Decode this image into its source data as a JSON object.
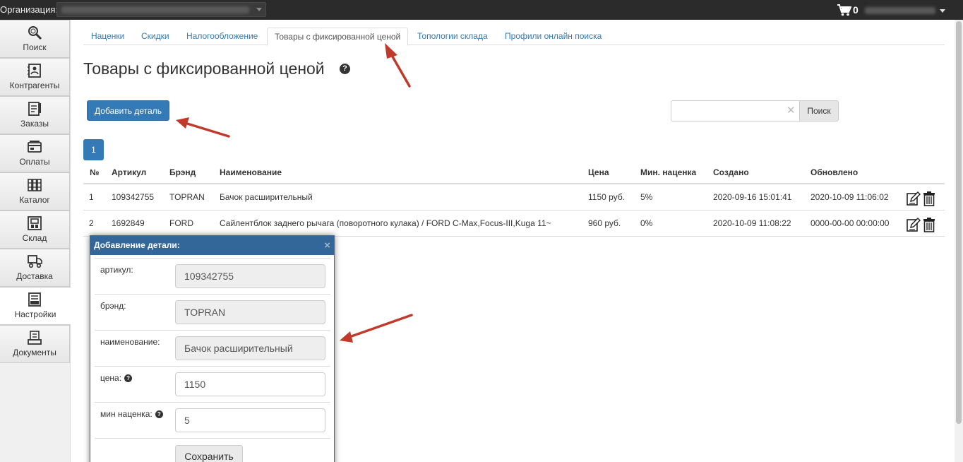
{
  "topbar": {
    "org_label": "Организация:",
    "cart_count": "0"
  },
  "sidebar": {
    "items": [
      {
        "label": "Поиск",
        "icon": "search-icon"
      },
      {
        "label": "Контрагенты",
        "icon": "contacts-icon"
      },
      {
        "label": "Заказы",
        "icon": "orders-icon"
      },
      {
        "label": "Оплаты",
        "icon": "payments-icon"
      },
      {
        "label": "Каталог",
        "icon": "catalog-icon"
      },
      {
        "label": "Склад",
        "icon": "warehouse-icon"
      },
      {
        "label": "Доставка",
        "icon": "delivery-icon"
      },
      {
        "label": "Настройки",
        "icon": "settings-icon",
        "active": true
      },
      {
        "label": "Документы",
        "icon": "documents-icon"
      }
    ]
  },
  "tabs": [
    {
      "label": "Наценки"
    },
    {
      "label": "Скидки"
    },
    {
      "label": "Налогообложение"
    },
    {
      "label": "Товары с фиксированной ценой",
      "active": true
    },
    {
      "label": "Топологии склада"
    },
    {
      "label": "Профили онлайн поиска"
    }
  ],
  "page": {
    "title": "Товары с фиксированной ценой",
    "add_button": "Добавить деталь",
    "search_button": "Поиск",
    "search_placeholder": "",
    "search_clear": "✕",
    "current_page": "1"
  },
  "table": {
    "headers": [
      "№",
      "Артикул",
      "Брэнд",
      "Наименование",
      "Цена",
      "Мин. наценка",
      "Создано",
      "Обновлено"
    ],
    "rows": [
      [
        "1",
        "109342755",
        "TOPRAN",
        "Бачок расширительный",
        "1150 руб.",
        "5%",
        "2020-09-16 15:01:41",
        "2020-10-09 11:06:02"
      ],
      [
        "2",
        "1692849",
        "FORD",
        "Сайлентблок заднего рычага (поворотного кулака) / FORD C-Max,Focus-III,Kuga 11~",
        "960 руб.",
        "0%",
        "2020-10-09 11:08:22",
        "0000-00-00 00:00:00"
      ]
    ]
  },
  "modal": {
    "title": "Добавление детали:",
    "close": "×",
    "fields": [
      {
        "label": "артикул:",
        "value": "109342755"
      },
      {
        "label": "брэнд:",
        "value": "TOPRAN"
      },
      {
        "label": "наименование:",
        "value": "Бачок расширительный"
      },
      {
        "label": "цена:",
        "value": "1150"
      },
      {
        "label": "мин наценка:",
        "value": "5"
      }
    ],
    "save_button": "Сохранить"
  },
  "colors": {
    "primary": "#337ab7",
    "modal_header": "#336699",
    "annotation_arrow": "#c0392b",
    "topbar": "#2b2b2b"
  }
}
